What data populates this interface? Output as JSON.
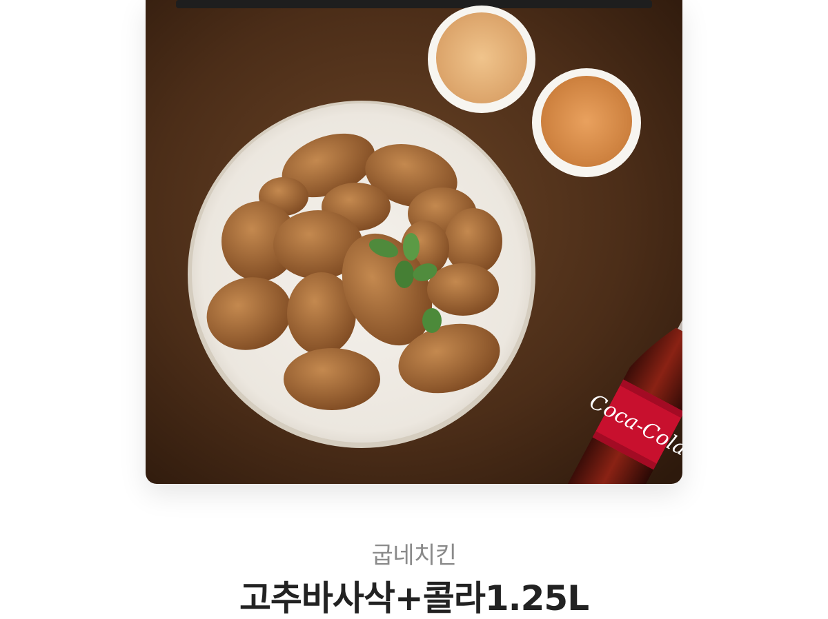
{
  "product_card": {
    "image_alt": "치킨과 콜라 세트 이미지",
    "brand": "굽네치킨",
    "name": "고추바사삭+콜라1.25L"
  },
  "colors": {
    "background": "#ffffff",
    "table": "#4a2c18",
    "plate": "#f1ede6",
    "chicken": "#a86a35",
    "sauce_yellow": "#e8b77a",
    "sauce_orange": "#d98f4e",
    "cola_label": "#c8102e",
    "brand_text": "#8a8a8a",
    "title_text": "#222222"
  }
}
